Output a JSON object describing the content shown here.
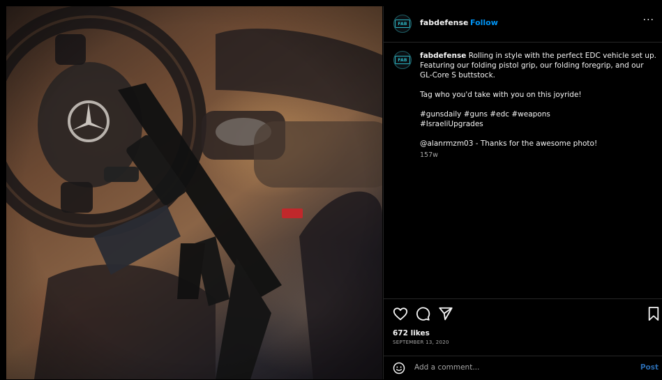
{
  "post": {
    "image_alt_icon": "post-photo",
    "header": {
      "avatar_text": "FAB",
      "username": "fabdefense",
      "separator": "•",
      "follow_label": "Follow",
      "more_label": "···"
    },
    "caption": {
      "avatar_text": "FAB",
      "username": "fabdefense",
      "line1": "Rolling in style with the perfect EDC vehicle set up. Featuring our folding pistol grip, our folding foregrip, and our GL-Core S buttstock.",
      "line2": "Tag who you'd take with you on this joyride!",
      "hashtags1": "#gunsdaily #guns #edc #weapons",
      "hashtags2": "#IsraeliUpgrades",
      "credit": "@alanrmzm03 - Thanks for the awesome photo!",
      "time_ago": "157w"
    },
    "actions": {
      "icons": [
        "heart-icon",
        "comment-icon",
        "share-icon",
        "bookmark-icon"
      ]
    },
    "likes": "672 likes",
    "date": "SEPTEMBER 13, 2020",
    "comment": {
      "placeholder": "Add a comment...",
      "post_label": "Post"
    }
  },
  "colors": {
    "background": "#000000",
    "text": "#f5f5f5",
    "muted": "#a8a8a8",
    "link_blue": "#0095f6",
    "post_disabled": "#2a6bb0",
    "divider": "#262626",
    "brand_teal": "#2bb4c2"
  }
}
